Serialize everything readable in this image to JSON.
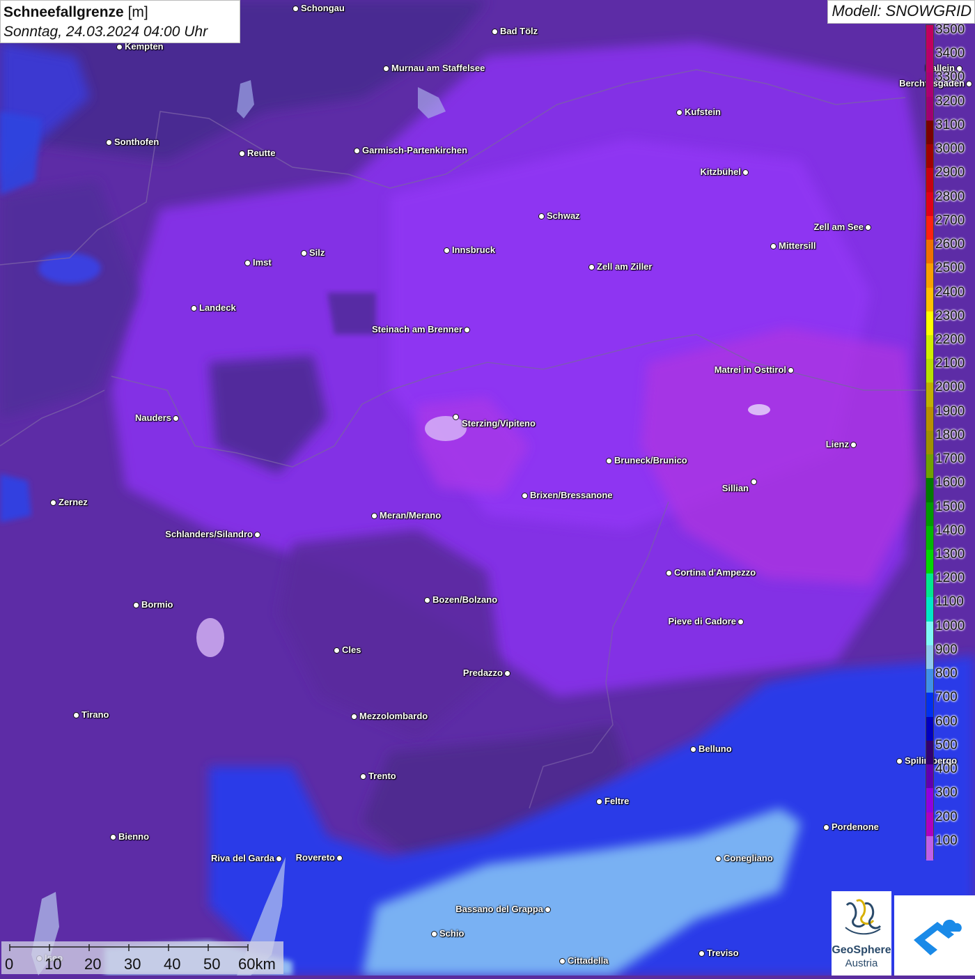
{
  "header": {
    "title": "Schneefallgrenze",
    "unit": "[m]",
    "datetime": "Sonntag, 24.03.2024 04:00 Uhr"
  },
  "model": {
    "label": "Modell: SNOWGRID"
  },
  "legend": {
    "labels": [
      "3500",
      "3400",
      "3300",
      "3200",
      "3100",
      "3000",
      "2900",
      "2800",
      "2700",
      "2600",
      "2500",
      "2400",
      "2300",
      "2200",
      "2100",
      "2000",
      "1900",
      "1800",
      "1700",
      "1600",
      "1500",
      "1400",
      "1300",
      "1200",
      "1100",
      "1000",
      "900",
      "800",
      "700",
      "600",
      "500",
      "400",
      "300",
      "200",
      "100"
    ],
    "colors": [
      "#c2005e",
      "#b8006a",
      "#ad0072",
      "#a00070",
      "#7a0000",
      "#a00000",
      "#c80010",
      "#e00018",
      "#ff2010",
      "#f07000",
      "#f8a000",
      "#ffc000",
      "#ffff00",
      "#d0f000",
      "#b8e000",
      "#c0b000",
      "#b89000",
      "#a09000",
      "#70a000",
      "#007a00",
      "#009a00",
      "#00b800",
      "#00d800",
      "#00e890",
      "#00e8c8",
      "#80f8f8",
      "#90c8f0",
      "#4090e8",
      "#0030f0",
      "#0000c0",
      "#300070",
      "#6000b0",
      "#9000e0",
      "#b000c0",
      "#c060e8"
    ]
  },
  "cities": [
    {
      "name": "Schongau"
    },
    {
      "name": "Bad Tölz"
    },
    {
      "name": "Kempten"
    },
    {
      "name": "Murnau am Staffelsee"
    },
    {
      "name": "Hallein"
    },
    {
      "name": "Berchtesgaden"
    },
    {
      "name": "Kufstein"
    },
    {
      "name": "Sonthofen"
    },
    {
      "name": "Reutte"
    },
    {
      "name": "Garmisch-Partenkirchen"
    },
    {
      "name": "Kitzbühel"
    },
    {
      "name": "Schwaz"
    },
    {
      "name": "Zell am See"
    },
    {
      "name": "Innsbruck"
    },
    {
      "name": "Mittersill"
    },
    {
      "name": "Imst"
    },
    {
      "name": "Silz"
    },
    {
      "name": "Zell am Ziller"
    },
    {
      "name": "Landeck"
    },
    {
      "name": "Steinach am Brenner"
    },
    {
      "name": "Matrei in Osttirol"
    },
    {
      "name": "Nauders"
    },
    {
      "name": "Sterzing/Vipiteno"
    },
    {
      "name": "Lienz"
    },
    {
      "name": "Bruneck/Brunico"
    },
    {
      "name": "Sillian"
    },
    {
      "name": "Zernez"
    },
    {
      "name": "Brixen/Bressanone"
    },
    {
      "name": "Meran/Merano"
    },
    {
      "name": "Schlanders/Silandro"
    },
    {
      "name": "Cortina d'Ampezzo"
    },
    {
      "name": "Bozen/Bolzano"
    },
    {
      "name": "Bormio"
    },
    {
      "name": "Pieve di Cadore"
    },
    {
      "name": "Cles"
    },
    {
      "name": "Predazzo"
    },
    {
      "name": "Tirano"
    },
    {
      "name": "Mezzolombardo"
    },
    {
      "name": "Belluno"
    },
    {
      "name": "Spilimbergo"
    },
    {
      "name": "Trento"
    },
    {
      "name": "Feltre"
    },
    {
      "name": "Pordenone"
    },
    {
      "name": "Bienno"
    },
    {
      "name": "Riva del Garda"
    },
    {
      "name": "Rovereto"
    },
    {
      "name": "Conegliano"
    },
    {
      "name": "Bassano del Grappa"
    },
    {
      "name": "Schio"
    },
    {
      "name": "Treviso"
    },
    {
      "name": "Cittadella"
    },
    {
      "name": "Iseo"
    }
  ],
  "scale": {
    "labels": [
      "0",
      "10",
      "20",
      "30",
      "40",
      "50",
      "60km"
    ]
  },
  "logos": {
    "geosphere_line1": "GeoSphere",
    "geosphere_line2": "Austria"
  }
}
